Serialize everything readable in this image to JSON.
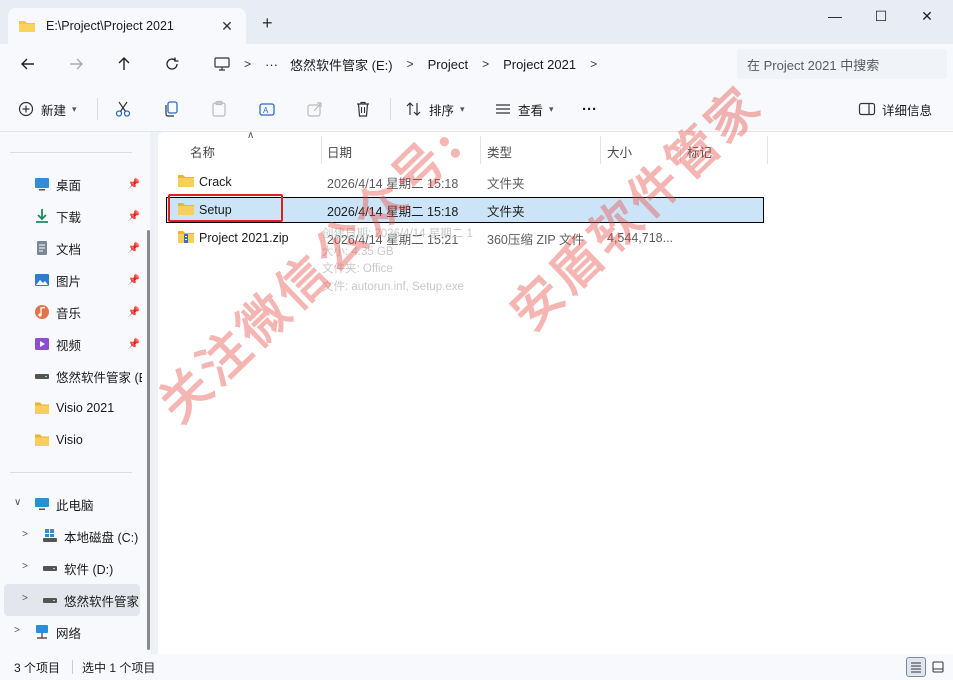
{
  "window": {
    "tab_title": "E:\\Project\\Project 2021",
    "new_tab": "+",
    "minimize": "—",
    "maximize": "☐",
    "close": "✕"
  },
  "address": {
    "more": "···",
    "crumbs": [
      "悠然软件管家 (E:)",
      "Project",
      "Project 2021"
    ],
    "search_placeholder": "在 Project 2021 中搜索"
  },
  "toolbar": {
    "new_label": "新建",
    "sort_label": "排序",
    "view_label": "查看",
    "more_label": "···",
    "details_label": "详细信息"
  },
  "sidebar": {
    "quick_access": [
      {
        "label": "桌面",
        "icon": "desktop-icon",
        "pinned": true
      },
      {
        "label": "下载",
        "icon": "download-icon",
        "pinned": true
      },
      {
        "label": "文档",
        "icon": "document-icon",
        "pinned": true
      },
      {
        "label": "图片",
        "icon": "pictures-icon",
        "pinned": true
      },
      {
        "label": "音乐",
        "icon": "music-icon",
        "pinned": true
      },
      {
        "label": "视频",
        "icon": "video-icon",
        "pinned": true
      },
      {
        "label": "悠然软件管家 (E",
        "icon": "drive-icon",
        "pinned": false
      },
      {
        "label": "Visio 2021",
        "icon": "folder-icon",
        "pinned": false
      },
      {
        "label": "Visio",
        "icon": "folder-icon",
        "pinned": false
      }
    ],
    "this_pc": "此电脑",
    "drives": [
      {
        "label": "本地磁盘 (C:)",
        "icon": "windows-drive-icon"
      },
      {
        "label": "软件 (D:)",
        "icon": "drive-icon"
      },
      {
        "label": "悠然软件管家",
        "icon": "drive-icon"
      }
    ],
    "network": "网络"
  },
  "columns": {
    "name": "名称",
    "date": "日期",
    "type": "类型",
    "size": "大小",
    "tags": "标记"
  },
  "files": [
    {
      "name": "Crack",
      "date": "2026/4/14 星期二 15:18",
      "type": "文件夹",
      "size": "",
      "icon": "folder-icon",
      "selected": false
    },
    {
      "name": "Setup",
      "date": "2026/4/14 星期二 15:18",
      "type": "文件夹",
      "size": "",
      "icon": "folder-icon",
      "selected": true
    },
    {
      "name": "Project 2021.zip",
      "date": "2026/4/14 星期二 15:21",
      "type": "360压缩 ZIP 文件",
      "size": "4,544,718...",
      "icon": "zip-icon",
      "selected": false
    }
  ],
  "tooltip": {
    "line1": "创建日期: 2026/4/14 星期二 1",
    "line2": "大小: 4.35 GB",
    "line3": "文件夹: Office",
    "line4": "文件: autorun.inf, Setup.exe"
  },
  "status": {
    "count": "3 个项目",
    "selected": "选中 1 个项目"
  },
  "watermark": {
    "line1": "关注微信公众号:",
    "line2": "安盾软件管家"
  },
  "colors": {
    "selection": "#cce4f7",
    "highlight_box": "#e0201e",
    "watermark": "#e6504b",
    "folder": "#f4c542"
  }
}
